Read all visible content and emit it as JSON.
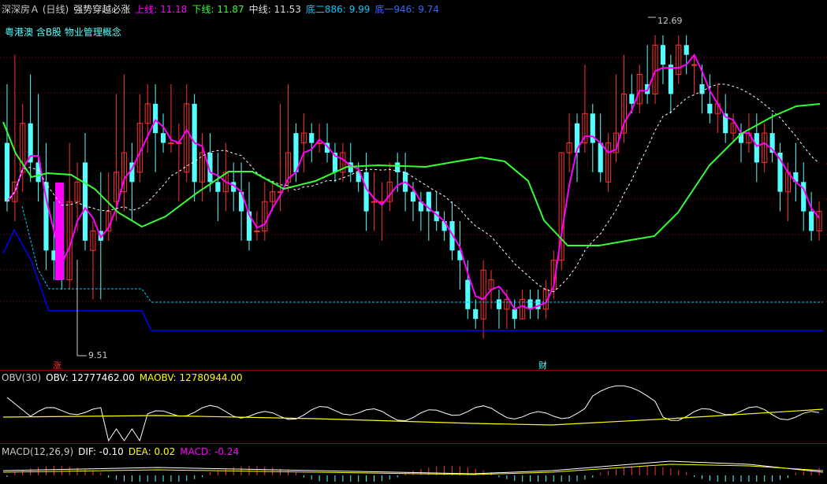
{
  "header": {
    "title": "深深房Ａ (日线)",
    "indicator": "强势穿越必涨",
    "upper_label": "上线:",
    "upper_value": "11.18",
    "lower_label": "下线:",
    "lower_value": "11.87",
    "mid_label": "中线:",
    "mid_value": "11.53",
    "bottom2_label": "底二886:",
    "bottom2_value": "9.99",
    "bottom1_label": "底一946:",
    "bottom1_value": "9.74"
  },
  "concepts": "粤港澳 含B股 物业管理概念",
  "annotations": {
    "high": "12.69",
    "low": "9.51",
    "zhang": "涨",
    "cai": "财"
  },
  "obv": {
    "name": "OBV(30)",
    "obv_label": "OBV:",
    "obv_value": "12777462.00",
    "maobv_label": "MAOBV:",
    "maobv_value": "12780944.00"
  },
  "macd": {
    "name": "MACD(12,26,9)",
    "dif_label": "DIF:",
    "dif_value": "-0.10",
    "dea_label": "DEA:",
    "dea_value": "0.02",
    "macd_label": "MACD:",
    "macd_value": "-0.24"
  },
  "colors": {
    "up": "#ff3232",
    "down": "#54ffff",
    "grid": "#8b0000",
    "magenta": "#ff00ff",
    "green": "#33ff33",
    "white": "#ffffff",
    "yellow": "#ffff00",
    "blue": "#0000ff",
    "labelBlue": "#00ccff"
  },
  "chart_data": {
    "type": "candlestick",
    "ylim": [
      9.4,
      12.9
    ],
    "candles": [
      [
        11.6,
        11.0,
        12.2,
        10.9
      ],
      [
        11.0,
        11.2,
        12.5,
        10.8
      ],
      [
        11.3,
        11.8,
        12.0,
        11.1
      ],
      [
        11.8,
        11.4,
        12.3,
        11.2
      ],
      [
        11.4,
        11.2,
        12.1,
        11.0
      ],
      [
        11.2,
        10.5,
        11.6,
        10.3
      ],
      [
        10.5,
        10.4,
        11.0,
        10.2
      ],
      [
        10.5,
        10.2,
        11.0,
        10.1
      ],
      [
        10.2,
        11.0,
        11.6,
        10.1
      ],
      [
        11.0,
        11.2,
        11.4,
        10.7
      ],
      [
        11.4,
        10.6,
        11.7,
        10.5
      ],
      [
        10.5,
        10.7,
        10.8,
        10.0
      ],
      [
        10.7,
        10.6,
        11.3,
        10.0
      ],
      [
        10.7,
        10.9,
        11.3,
        10.6
      ],
      [
        11.0,
        11.3,
        12.1,
        10.8
      ],
      [
        11.1,
        11.5,
        12.3,
        10.9
      ],
      [
        11.4,
        11.2,
        11.6,
        10.8
      ],
      [
        11.3,
        11.8,
        12.1,
        11.2
      ],
      [
        11.8,
        12.0,
        12.2,
        11.5
      ],
      [
        12.0,
        11.7,
        12.2,
        11.3
      ],
      [
        11.7,
        11.6,
        11.9,
        11.5
      ],
      [
        11.6,
        11.6,
        12.2,
        11.5
      ],
      [
        11.6,
        11.6,
        11.8,
        11.0
      ],
      [
        11.3,
        12.0,
        12.2,
        11.2
      ],
      [
        12.0,
        11.2,
        12.1,
        11.0
      ],
      [
        11.2,
        11.5,
        11.7,
        11.0
      ],
      [
        11.5,
        11.2,
        11.7,
        11.1
      ],
      [
        11.2,
        11.1,
        11.5,
        10.8
      ],
      [
        11.1,
        11.3,
        11.6,
        10.9
      ],
      [
        11.2,
        11.1,
        11.4,
        10.9
      ],
      [
        11.1,
        10.9,
        11.4,
        10.6
      ],
      [
        10.9,
        10.6,
        11.2,
        10.5
      ],
      [
        10.7,
        10.7,
        10.9,
        10.6
      ],
      [
        10.7,
        11.0,
        11.2,
        10.6
      ],
      [
        11.0,
        11.1,
        11.2,
        10.9
      ],
      [
        11.1,
        11.1,
        12.0,
        10.9
      ],
      [
        11.2,
        11.5,
        12.2,
        11.1
      ],
      [
        11.7,
        11.3,
        11.8,
        11.2
      ],
      [
        11.6,
        11.7,
        11.9,
        11.3
      ],
      [
        11.7,
        11.6,
        11.8,
        11.4
      ],
      [
        11.6,
        11.6,
        11.8,
        11.5
      ],
      [
        11.6,
        11.5,
        11.8,
        11.4
      ],
      [
        11.5,
        11.3,
        11.6,
        11.2
      ],
      [
        11.3,
        11.5,
        11.6,
        11.2
      ],
      [
        11.4,
        11.3,
        11.6,
        11.2
      ],
      [
        11.3,
        11.2,
        11.4,
        11.1
      ],
      [
        11.3,
        10.9,
        11.5,
        10.7
      ],
      [
        11.0,
        11.0,
        11.3,
        10.7
      ],
      [
        11.0,
        11.0,
        11.2,
        10.6
      ],
      [
        11.0,
        11.2,
        11.4,
        10.9
      ],
      [
        11.4,
        11.3,
        11.5,
        11.1
      ],
      [
        11.3,
        11.1,
        11.5,
        10.9
      ],
      [
        11.1,
        11.0,
        11.2,
        10.8
      ],
      [
        11.0,
        10.9,
        11.1,
        10.7
      ],
      [
        11.1,
        10.9,
        11.1,
        10.6
      ],
      [
        10.9,
        10.8,
        11.1,
        10.7
      ],
      [
        10.8,
        10.7,
        10.9,
        10.6
      ],
      [
        10.8,
        10.5,
        11.0,
        10.4
      ],
      [
        10.5,
        10.4,
        10.8,
        10.1
      ],
      [
        10.2,
        9.9,
        10.4,
        9.8
      ],
      [
        9.9,
        9.8,
        10.0,
        9.7
      ],
      [
        9.8,
        10.3,
        10.4,
        9.6
      ],
      [
        10.1,
        10.2,
        10.3,
        9.9
      ],
      [
        10.0,
        9.9,
        10.1,
        9.7
      ],
      [
        9.9,
        10.0,
        10.1,
        9.7
      ],
      [
        9.9,
        9.8,
        10.0,
        9.7
      ],
      [
        9.8,
        10.0,
        10.1,
        9.8
      ],
      [
        10.0,
        9.9,
        10.1,
        9.8
      ],
      [
        10.0,
        9.9,
        10.1,
        9.8
      ],
      [
        9.9,
        10.1,
        10.2,
        9.8
      ],
      [
        10.1,
        10.4,
        10.5,
        10.0
      ],
      [
        10.4,
        11.5,
        11.5,
        10.3
      ],
      [
        11.5,
        11.6,
        11.9,
        11.3
      ],
      [
        11.8,
        11.5,
        11.9,
        11.2
      ],
      [
        11.6,
        11.9,
        12.4,
        11.5
      ],
      [
        11.9,
        11.6,
        12.0,
        11.3
      ],
      [
        11.6,
        11.3,
        11.9,
        11.2
      ],
      [
        11.2,
        11.6,
        11.7,
        11.1
      ],
      [
        11.5,
        11.7,
        12.3,
        11.4
      ],
      [
        11.7,
        12.1,
        12.5,
        11.6
      ],
      [
        12.1,
        12.0,
        12.3,
        11.9
      ],
      [
        12.0,
        12.3,
        12.4,
        11.9
      ],
      [
        12.2,
        12.1,
        12.6,
        12.0
      ],
      [
        12.1,
        12.6,
        12.7,
        12.0
      ],
      [
        12.6,
        12.4,
        12.7,
        12.2
      ],
      [
        12.4,
        12.1,
        12.5,
        11.9
      ],
      [
        12.3,
        12.6,
        12.7,
        12.2
      ],
      [
        12.6,
        12.5,
        12.7,
        12.3
      ],
      [
        12.4,
        12.4,
        12.5,
        12.1
      ],
      [
        12.2,
        12.1,
        12.4,
        11.9
      ],
      [
        12.0,
        11.9,
        12.3,
        11.8
      ],
      [
        11.9,
        12.0,
        12.2,
        11.7
      ],
      [
        11.9,
        11.7,
        12.1,
        11.6
      ],
      [
        11.7,
        11.8,
        11.9,
        11.6
      ],
      [
        11.7,
        11.6,
        11.8,
        11.4
      ],
      [
        11.6,
        11.7,
        11.9,
        11.5
      ],
      [
        11.7,
        11.4,
        11.9,
        11.2
      ],
      [
        11.4,
        11.7,
        11.8,
        11.3
      ],
      [
        11.7,
        11.5,
        11.9,
        11.4
      ],
      [
        11.5,
        11.1,
        11.6,
        10.9
      ],
      [
        11.1,
        11.3,
        11.4,
        10.8
      ],
      [
        11.3,
        11.2,
        11.6,
        11.0
      ],
      [
        11.2,
        10.9,
        11.4,
        10.7
      ],
      [
        10.9,
        10.7,
        11.1,
        10.6
      ],
      [
        10.7,
        10.9,
        11.0,
        10.6
      ]
    ]
  }
}
